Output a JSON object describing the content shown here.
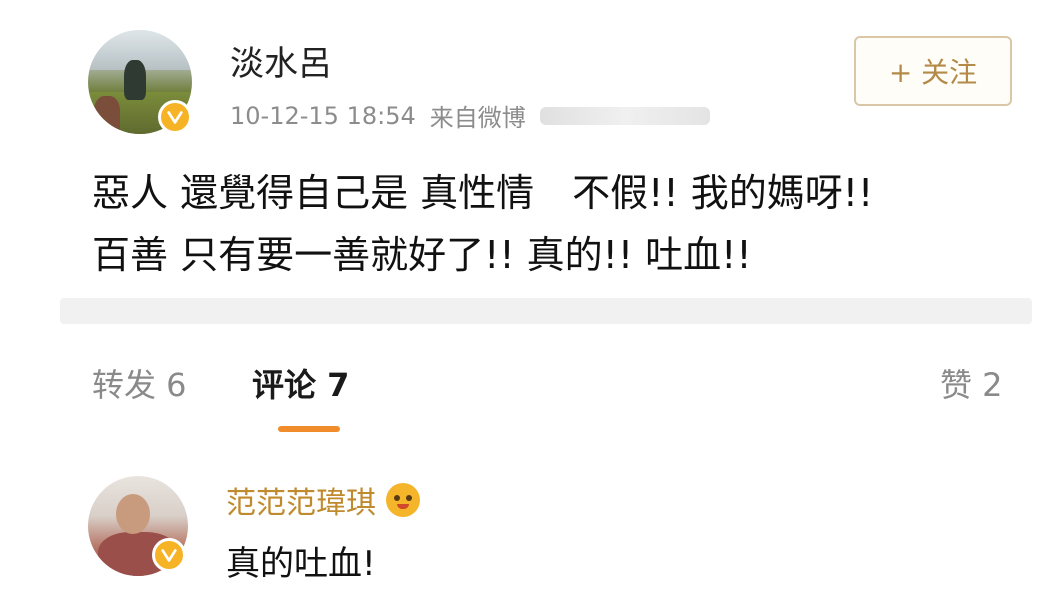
{
  "post": {
    "username": "淡水呂",
    "timestamp": "10-12-15 18:54",
    "source": "来自微博",
    "follow_label": "+ 关注",
    "text_line1": "惡人 還覺得自己是 真性情　不假!! 我的媽呀!!",
    "text_line2": "百善 只有要一善就好了!! 真的!! 吐血!!",
    "verified_badge_color": "#f5b325"
  },
  "tabs": {
    "retweet": "转发 6",
    "comments": "评论 7",
    "likes": "赞 2",
    "active": "comments",
    "accent_color": "#f08c2a"
  },
  "comment": {
    "username": "范范范瑋琪",
    "text": "真的吐血!",
    "name_color": "#c08a2e"
  }
}
